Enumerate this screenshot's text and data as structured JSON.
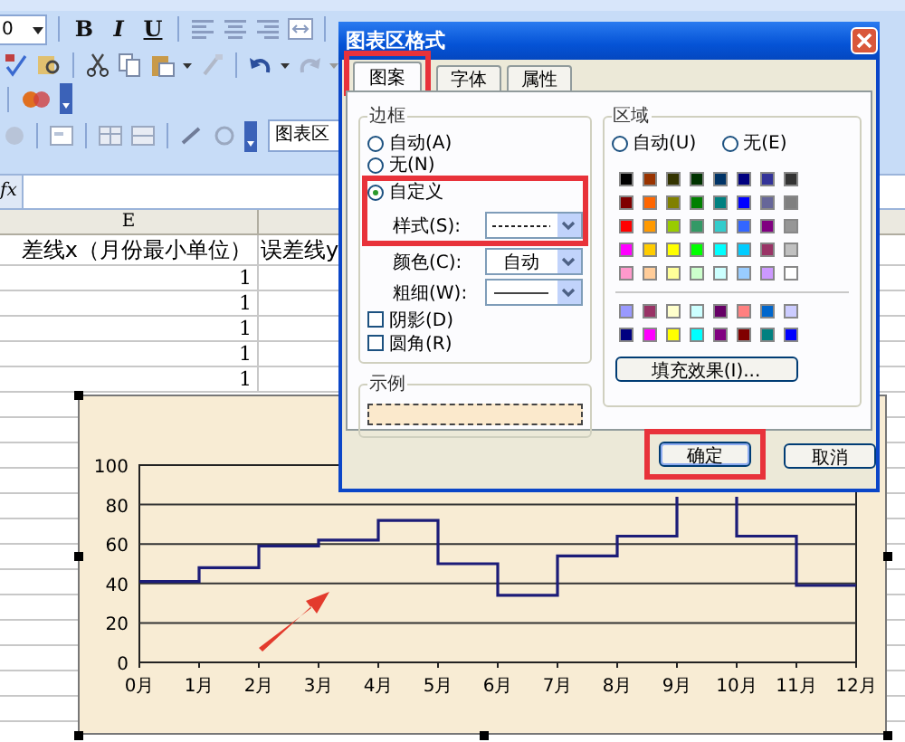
{
  "toolbar": {
    "font_size": "0",
    "format_buttons": [
      {
        "label": "B",
        "kind": "bold"
      },
      {
        "label": "I",
        "kind": "italic"
      },
      {
        "label": "U",
        "kind": "underline"
      }
    ],
    "object_field": "图表区"
  },
  "formula_bar": {
    "function_label": "fx"
  },
  "sheet": {
    "column_header": "E",
    "headers": [
      "差线x（月份最小单位）",
      "误差线y"
    ],
    "rows": [
      [
        "1"
      ],
      [
        "1"
      ],
      [
        "1"
      ],
      [
        "1"
      ],
      [
        "1"
      ]
    ]
  },
  "chart": {
    "chart_data": {
      "type": "line",
      "grid": true,
      "xlim": [
        0,
        12
      ],
      "ylim": [
        0,
        100
      ],
      "xticks": [
        {
          "value": 0,
          "label": "0月"
        },
        {
          "value": 1,
          "label": "1月"
        },
        {
          "value": 2,
          "label": "2月"
        },
        {
          "value": 3,
          "label": "3月"
        },
        {
          "value": 4,
          "label": "4月"
        },
        {
          "value": 5,
          "label": "5月"
        },
        {
          "value": 6,
          "label": "6月"
        },
        {
          "value": 7,
          "label": "7月"
        },
        {
          "value": 8,
          "label": "8月"
        },
        {
          "value": 9,
          "label": "9月"
        },
        {
          "value": 10,
          "label": "10月"
        },
        {
          "value": 11,
          "label": "11月"
        },
        {
          "value": 12,
          "label": "12月"
        }
      ],
      "yticks": [
        0,
        20,
        40,
        60,
        80,
        100
      ],
      "x": [
        0,
        1,
        1,
        2,
        2,
        3,
        3,
        4,
        4,
        5,
        5,
        6,
        6,
        7,
        7,
        8,
        8,
        9,
        9,
        9.5,
        10,
        10,
        11,
        11,
        12
      ],
      "series": [
        {
          "color": "#1c1c78",
          "values": [
            41,
            41,
            48,
            48,
            59,
            59,
            62,
            62,
            72,
            72,
            50,
            50,
            34,
            34,
            54,
            54,
            64,
            64,
            84,
            null,
            84,
            64,
            64,
            39,
            39
          ]
        }
      ]
    }
  },
  "dialog": {
    "title": "图表区格式",
    "tabs": [
      {
        "label": "图案",
        "selected": true,
        "highlighted": true
      },
      {
        "label": "字体",
        "selected": false,
        "highlighted": false
      },
      {
        "label": "属性",
        "selected": false,
        "highlighted": false
      }
    ],
    "border": {
      "title": "边框",
      "options": [
        {
          "label": "自动(A)",
          "selected": false
        },
        {
          "label": "无(N)",
          "selected": false
        },
        {
          "label": "自定义",
          "selected": true
        }
      ],
      "highlight": true,
      "style_label": "样式(S):",
      "color_label": "颜色(C):",
      "color_value": "自动",
      "weight_label": "粗细(W):",
      "checks": [
        {
          "label": "阴影(D)",
          "checked": false
        },
        {
          "label": "圆角(R)",
          "checked": false
        }
      ]
    },
    "sample_title": "示例",
    "area": {
      "title": "区域",
      "options": [
        {
          "label": "自动(U)",
          "selected": false
        },
        {
          "label": "无(E)",
          "selected": false
        }
      ],
      "swatches": [
        {
          "color": "#000000"
        },
        {
          "color": "#993300"
        },
        {
          "color": "#333300"
        },
        {
          "color": "#003300"
        },
        {
          "color": "#003366"
        },
        {
          "color": "#000080"
        },
        {
          "color": "#333399"
        },
        {
          "color": "#333333"
        },
        {
          "color": "#800000"
        },
        {
          "color": "#ff6600"
        },
        {
          "color": "#808000"
        },
        {
          "color": "#008000"
        },
        {
          "color": "#008080"
        },
        {
          "color": "#0000ff"
        },
        {
          "color": "#666699"
        },
        {
          "color": "#808080"
        },
        {
          "color": "#ff0000"
        },
        {
          "color": "#ff9900"
        },
        {
          "color": "#99cc00"
        },
        {
          "color": "#339966"
        },
        {
          "color": "#33cccc"
        },
        {
          "color": "#3366ff"
        },
        {
          "color": "#800080"
        },
        {
          "color": "#969696"
        },
        {
          "color": "#ff00ff"
        },
        {
          "color": "#ffcc00"
        },
        {
          "color": "#ffff00"
        },
        {
          "color": "#00ff00"
        },
        {
          "color": "#00ffff"
        },
        {
          "color": "#00ccff"
        },
        {
          "color": "#993366"
        },
        {
          "color": "#c0c0c0"
        },
        {
          "color": "#ff99cc"
        },
        {
          "color": "#ffcc99"
        },
        {
          "color": "#ffff99"
        },
        {
          "color": "#ccffcc"
        },
        {
          "color": "#ccffff"
        },
        {
          "color": "#99ccff"
        },
        {
          "color": "#cc99ff"
        },
        {
          "color": "#ffffff"
        }
      ],
      "extra_swatches": [
        {
          "color": "#9999ff"
        },
        {
          "color": "#993366"
        },
        {
          "color": "#ffffcc"
        },
        {
          "color": "#ccffff"
        },
        {
          "color": "#660066"
        },
        {
          "color": "#ff8080"
        },
        {
          "color": "#0066cc"
        },
        {
          "color": "#ccccff"
        },
        {
          "color": "#000080"
        },
        {
          "color": "#ff00ff"
        },
        {
          "color": "#ffff00"
        },
        {
          "color": "#00ffff"
        },
        {
          "color": "#800080"
        },
        {
          "color": "#800000"
        },
        {
          "color": "#008080"
        },
        {
          "color": "#0000ff"
        }
      ],
      "fill_button": "填充效果(I)..."
    },
    "buttons": [
      {
        "label": "确定",
        "highlighted": true
      },
      {
        "label": "取消",
        "highlighted": false
      }
    ]
  }
}
